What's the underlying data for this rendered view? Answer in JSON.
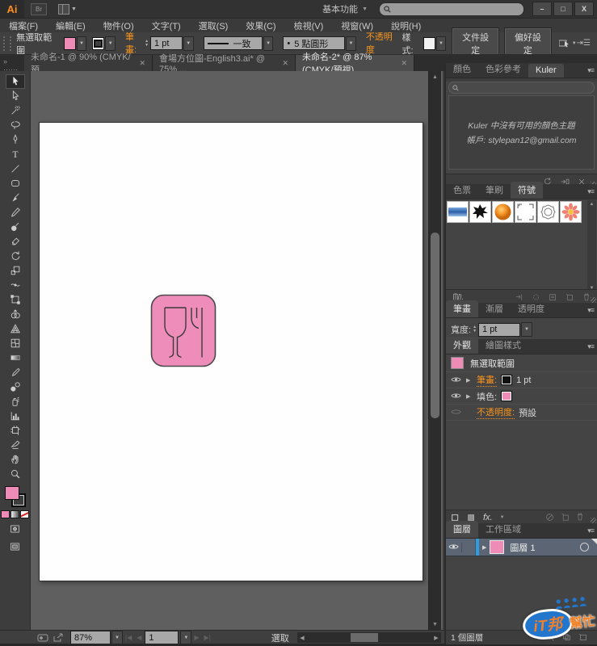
{
  "titlebar": {
    "app_logo": "Ai",
    "bridge_label": "Br",
    "workspace": "基本功能",
    "search_placeholder": "",
    "minimize": "–",
    "maximize": "□",
    "close": "X"
  },
  "menubar": {
    "items": [
      "檔案(F)",
      "編輯(E)",
      "物件(O)",
      "文字(T)",
      "選取(S)",
      "效果(C)",
      "檢視(V)",
      "視窗(W)",
      "說明(H)"
    ]
  },
  "controlbar": {
    "selection_status": "無選取範圍",
    "stroke_label": "筆畫:",
    "stroke_width": "1 pt",
    "profile": "一致",
    "brush_definition": "5 點圓形",
    "brush_bullet": "•",
    "opacity_label": "不透明度",
    "style_label": "樣式:",
    "doc_setup_button": "文件設定",
    "preferences_button": "偏好設定"
  },
  "doc_tabs": [
    {
      "title": "未命名-1 @ 90% (CMYK/預...",
      "close": "✕"
    },
    {
      "title": "會場方位圖-English3.ai* @ 75% ...",
      "close": "✕"
    },
    {
      "title": "未命名-2* @ 87% (CMYK/預視)",
      "close": "✕"
    }
  ],
  "panels": {
    "kuler": {
      "tab_color": "顏色",
      "tab_guide": "色彩參考",
      "tab_kuler": "Kuler",
      "message_line1": "Kuler 中沒有可用的顏色主題",
      "message_line2": "帳戶: stylepan12@gmail.com"
    },
    "symbols": {
      "tab_swatches": "色票",
      "tab_brushes": "筆刷",
      "tab_symbols": "符號"
    },
    "stroke": {
      "tab_stroke": "筆畫",
      "tab_gradient": "漸層",
      "tab_transparency": "透明度",
      "width_label": "寬度:",
      "width_value": "1 pt"
    },
    "appearance": {
      "tab_appearance": "外觀",
      "tab_graphic_styles": "繪圖樣式",
      "no_selection": "無選取範圍",
      "stroke_label": "筆畫:",
      "stroke_value": "1 pt",
      "fill_label": "填色:",
      "opacity_label": "不透明度:",
      "opacity_value": "預設",
      "fx_label": "fx."
    },
    "layers": {
      "tab_layers": "圖層",
      "tab_artboards": "工作區域",
      "layer_name": "圖層 1",
      "count_text": "1 個圖層"
    }
  },
  "statusbar": {
    "zoom": "87%",
    "artboard_number": "1",
    "status": "選取"
  },
  "watermark": {
    "badge": "iT邦",
    "suffix": "幫忙"
  },
  "colors": {
    "pink": "#ee8bb7",
    "orange_link": "#f7941d",
    "layer_selected": "#5b6573",
    "artboard_white": "#fefefe",
    "ui_dark": "#3d3d3d"
  }
}
